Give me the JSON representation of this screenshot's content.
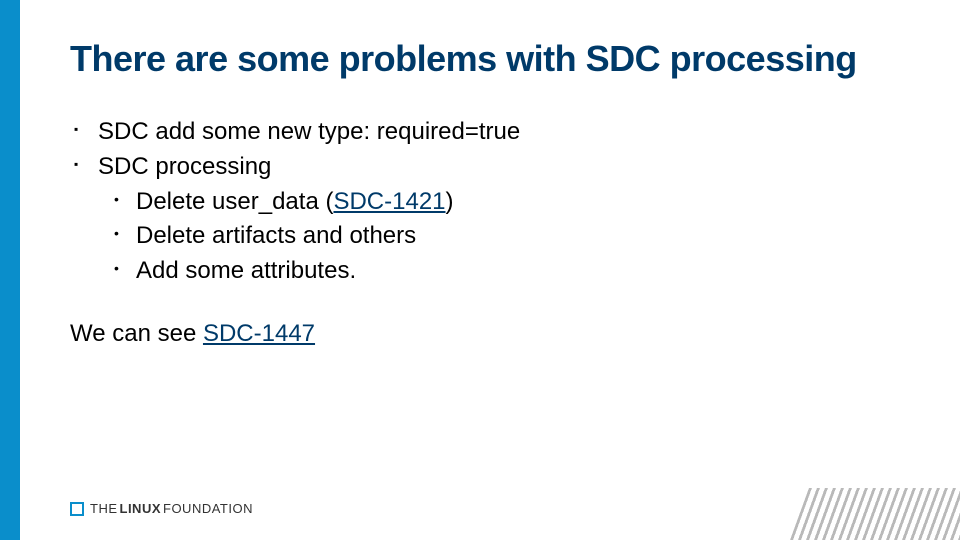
{
  "title": "There are some problems with SDC processing",
  "bullets": [
    {
      "text": "SDC add some new type: required=true"
    },
    {
      "text": "SDC processing",
      "children": [
        {
          "prefix": "Delete user_data (",
          "link": "SDC-1421",
          "suffix": ")"
        },
        {
          "text": "Delete artifacts and others"
        },
        {
          "text": "Add some attributes."
        }
      ]
    }
  ],
  "closing": {
    "prefix": "We can see ",
    "link": "SDC-1447"
  },
  "footer": {
    "the": "THE",
    "linux": "LINUX",
    "foundation": "FOUNDATION"
  }
}
